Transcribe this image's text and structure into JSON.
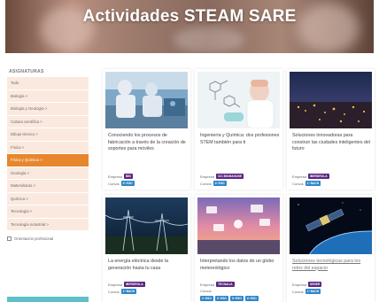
{
  "header": {
    "title": "Actividades STEAM SARE"
  },
  "sidebar": {
    "title": "ASIGNATURAS",
    "items": [
      {
        "label": "Todo"
      },
      {
        "label": "Biología",
        "chevron": ">"
      },
      {
        "label": "Biología y Geología",
        "chevron": ">"
      },
      {
        "label": "Cultura científica",
        "chevron": ">"
      },
      {
        "label": "Dibujo técnico",
        "chevron": ">"
      },
      {
        "label": "Física",
        "chevron": ">"
      },
      {
        "label": "Física y Química",
        "chevron": ">",
        "active": true
      },
      {
        "label": "Geología",
        "chevron": ">"
      },
      {
        "label": "Matemáticas",
        "chevron": ">"
      },
      {
        "label": "Química",
        "chevron": ">"
      },
      {
        "label": "Tecnología",
        "chevron": ">"
      },
      {
        "label": "Tecnología industrial",
        "chevron": ">"
      }
    ],
    "checkbox_label": "Orientación profesional"
  },
  "cards": [
    {
      "title": "Conociendo los procesos de fabricación a través de la creación de soportes para móviles",
      "empresa_label": "Empresa",
      "empresa_badge": "BBI",
      "cursos_label": "Cursos",
      "cursos": [
        "3º ESO"
      ]
    },
    {
      "title": "Ingeniería y Química: dos profesiones STEM también para ti",
      "empresa_label": "Empresa",
      "empresa_badge": "CIC BIOMAGUNE",
      "cursos_label": "Cursos",
      "cursos": [
        "4º ESO"
      ]
    },
    {
      "title": "Soluciones innovadoras para construir las ciudades inteligentes del futuro",
      "empresa_label": "Empresa",
      "empresa_badge": "IBERDROLA",
      "cursos_label": "Cursos",
      "cursos": [
        "1º BACH"
      ]
    },
    {
      "title": "La energía eléctrica desde la generación hasta tu casa",
      "empresa_label": "Empresa",
      "empresa_badge": "IBERDROLA",
      "cursos_label": "Cursos",
      "cursos": [
        "1º BACH"
      ]
    },
    {
      "title": "Interpretando los datos de un globo meteorológico",
      "empresa_label": "Empresa",
      "empresa_badge": "TECNALIA",
      "cursos_label": "Cursos",
      "cursos": [
        "1º ESO",
        "2º ESO",
        "3º ESO",
        "4º ESO"
      ]
    },
    {
      "title": "Soluciones tecnológicas para los retos del espacio",
      "empresa_label": "Empresa",
      "empresa_badge": "SENER",
      "cursos_label": "Cursos",
      "cursos": [
        "1º BACH"
      ]
    }
  ]
}
